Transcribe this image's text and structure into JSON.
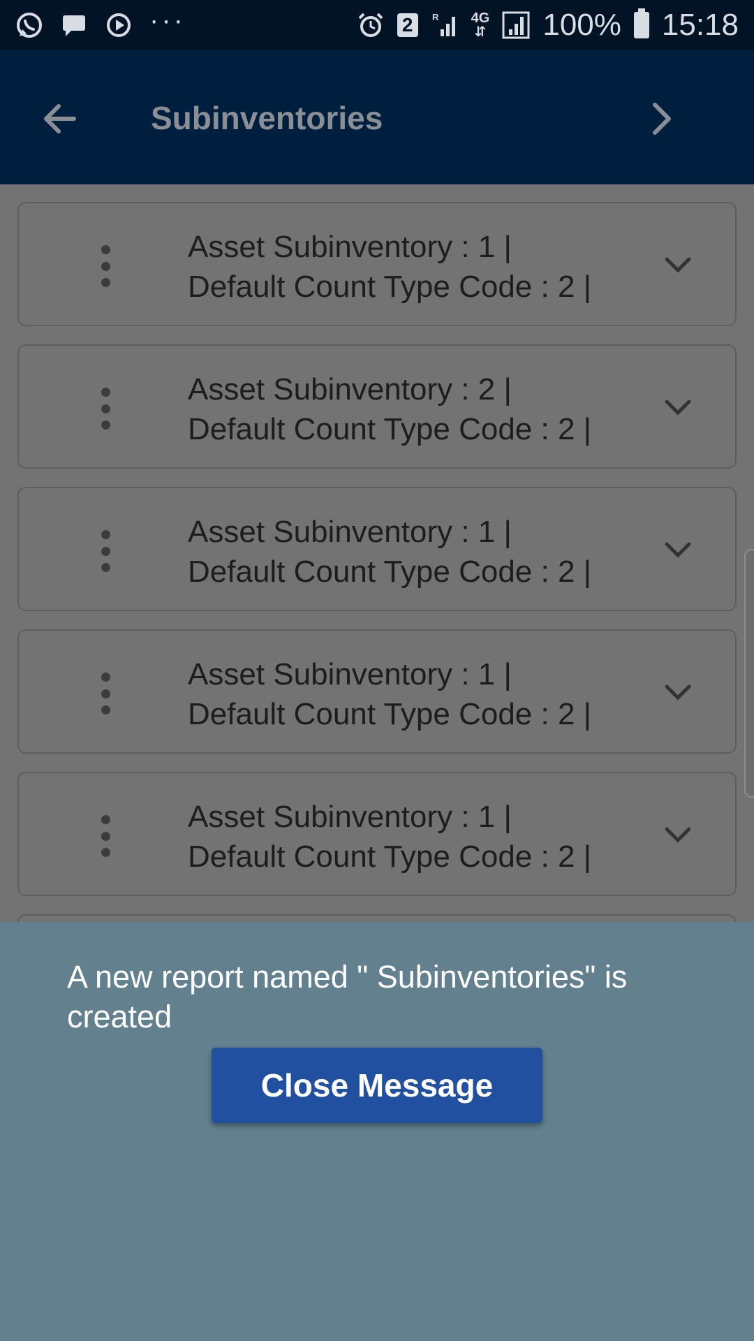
{
  "status_bar": {
    "left_icons": [
      "whatsapp-icon",
      "chat-icon",
      "media-play-icon"
    ],
    "overflow": "···",
    "sim_number": "2",
    "network_label": "4G",
    "battery_percent": "100%",
    "time": "15:18"
  },
  "app_bar": {
    "title": "Subinventories",
    "back_icon": "arrow-left-icon",
    "next_icon": "chevron-right-icon"
  },
  "list": {
    "items": [
      {
        "line1": "Asset Subinventory : 1 |",
        "line2": "Default Count Type Code : 2 |"
      },
      {
        "line1": "Asset Subinventory : 2 |",
        "line2": "Default Count Type Code : 2 |"
      },
      {
        "line1": "Asset Subinventory : 1 |",
        "line2": "Default Count Type Code : 2 |"
      },
      {
        "line1": "Asset Subinventory : 1 |",
        "line2": "Default Count Type Code : 2 |"
      },
      {
        "line1": "Asset Subinventory : 1 |",
        "line2": "Default Count Type Code : 2 |"
      }
    ]
  },
  "message": {
    "text": "A new report named \" Subinventories\" is created",
    "close_label": "Close Message"
  },
  "colors": {
    "status_bar": "#021326",
    "app_bar": "#001f3f",
    "overlay_bg": "#737373",
    "sheet": "#62808e",
    "button": "#2250a0"
  }
}
